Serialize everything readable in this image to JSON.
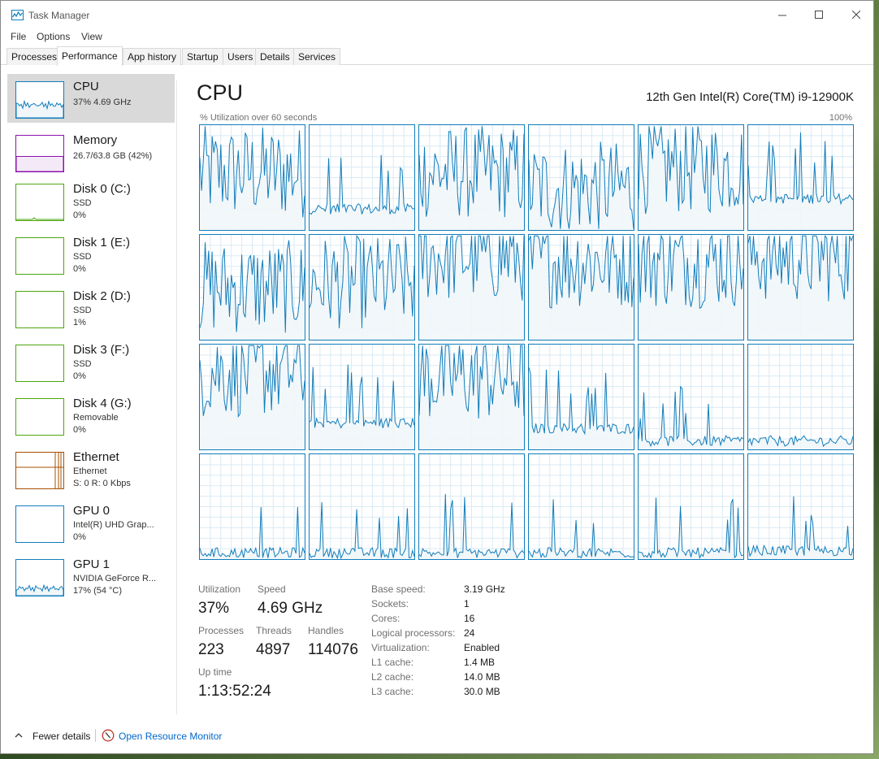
{
  "window": {
    "title": "Task Manager"
  },
  "menu": [
    "File",
    "Options",
    "View"
  ],
  "tabs": [
    "Processes",
    "Performance",
    "App history",
    "Startup",
    "Users",
    "Details",
    "Services"
  ],
  "active_tab": "Performance",
  "sidebar": {
    "items": [
      {
        "name": "CPU",
        "line1": "37%  4.69 GHz",
        "line2": "",
        "line3": "",
        "kind": "cpu",
        "color": "#117dbb",
        "active": true
      },
      {
        "name": "Memory",
        "line1": "26.7/63.8 GB (42%)",
        "line2": "",
        "line3": "",
        "kind": "memory",
        "color": "#8b12ae",
        "fill_fraction": 0.42
      },
      {
        "name": "Disk 0 (C:)",
        "line1": "SSD",
        "line2": "0%",
        "line3": "",
        "kind": "disk",
        "color": "#4da60c"
      },
      {
        "name": "Disk 1 (E:)",
        "line1": "SSD",
        "line2": "0%",
        "line3": "",
        "kind": "disk",
        "color": "#4da60c"
      },
      {
        "name": "Disk 2 (D:)",
        "line1": "SSD",
        "line2": "1%",
        "line3": "",
        "kind": "disk",
        "color": "#4da60c"
      },
      {
        "name": "Disk 3 (F:)",
        "line1": "SSD",
        "line2": "0%",
        "line3": "",
        "kind": "disk",
        "color": "#4da60c"
      },
      {
        "name": "Disk 4 (G:)",
        "line1": "Removable",
        "line2": "0%",
        "line3": "",
        "kind": "disk",
        "color": "#4da60c"
      },
      {
        "name": "Ethernet",
        "line1": "Ethernet",
        "line2": "S: 0  R: 0 Kbps",
        "line3": "",
        "kind": "ethernet",
        "color": "#a74f01"
      },
      {
        "name": "GPU 0",
        "line1": "Intel(R) UHD Grap...",
        "line2": "0%",
        "line3": "",
        "kind": "gpu",
        "color": "#117dbb"
      },
      {
        "name": "GPU 1",
        "line1": "NVIDIA GeForce R...",
        "line2": "17% (54 °C)",
        "line3": "",
        "kind": "gpu",
        "color": "#117dbb"
      }
    ]
  },
  "main": {
    "title": "CPU",
    "model": "12th Gen Intel(R) Core(TM) i9-12900K",
    "graph_caption": "% Utilization over 60 seconds",
    "graph_max": "100%",
    "line_color": "#117dbb",
    "fill_color": "#f1f6fa",
    "grid_color": "#d9eaf4",
    "core_levels": [
      0.55,
      0.2,
      0.55,
      0.4,
      0.6,
      0.3,
      0.5,
      0.55,
      0.8,
      0.75,
      0.75,
      0.8,
      0.75,
      0.25,
      0.7,
      0.2,
      0.08,
      0.08,
      0.06,
      0.06,
      0.06,
      0.06,
      0.06,
      0.08
    ]
  },
  "stats": {
    "utilization_label": "Utilization",
    "utilization": "37%",
    "speed_label": "Speed",
    "speed": "4.69 GHz",
    "processes_label": "Processes",
    "processes": "223",
    "threads_label": "Threads",
    "threads": "4897",
    "handles_label": "Handles",
    "handles": "114076",
    "uptime_label": "Up time",
    "uptime": "1:13:52:24"
  },
  "specs": [
    {
      "label": "Base speed:",
      "value": "3.19 GHz"
    },
    {
      "label": "Sockets:",
      "value": "1"
    },
    {
      "label": "Cores:",
      "value": "16"
    },
    {
      "label": "Logical processors:",
      "value": "24"
    },
    {
      "label": "Virtualization:",
      "value": "Enabled"
    },
    {
      "label": "L1 cache:",
      "value": "1.4 MB"
    },
    {
      "label": "L2 cache:",
      "value": "14.0 MB"
    },
    {
      "label": "L3 cache:",
      "value": "30.0 MB"
    }
  ],
  "footer": {
    "fewer_details": "Fewer details",
    "open_resource_monitor": "Open Resource Monitor"
  }
}
